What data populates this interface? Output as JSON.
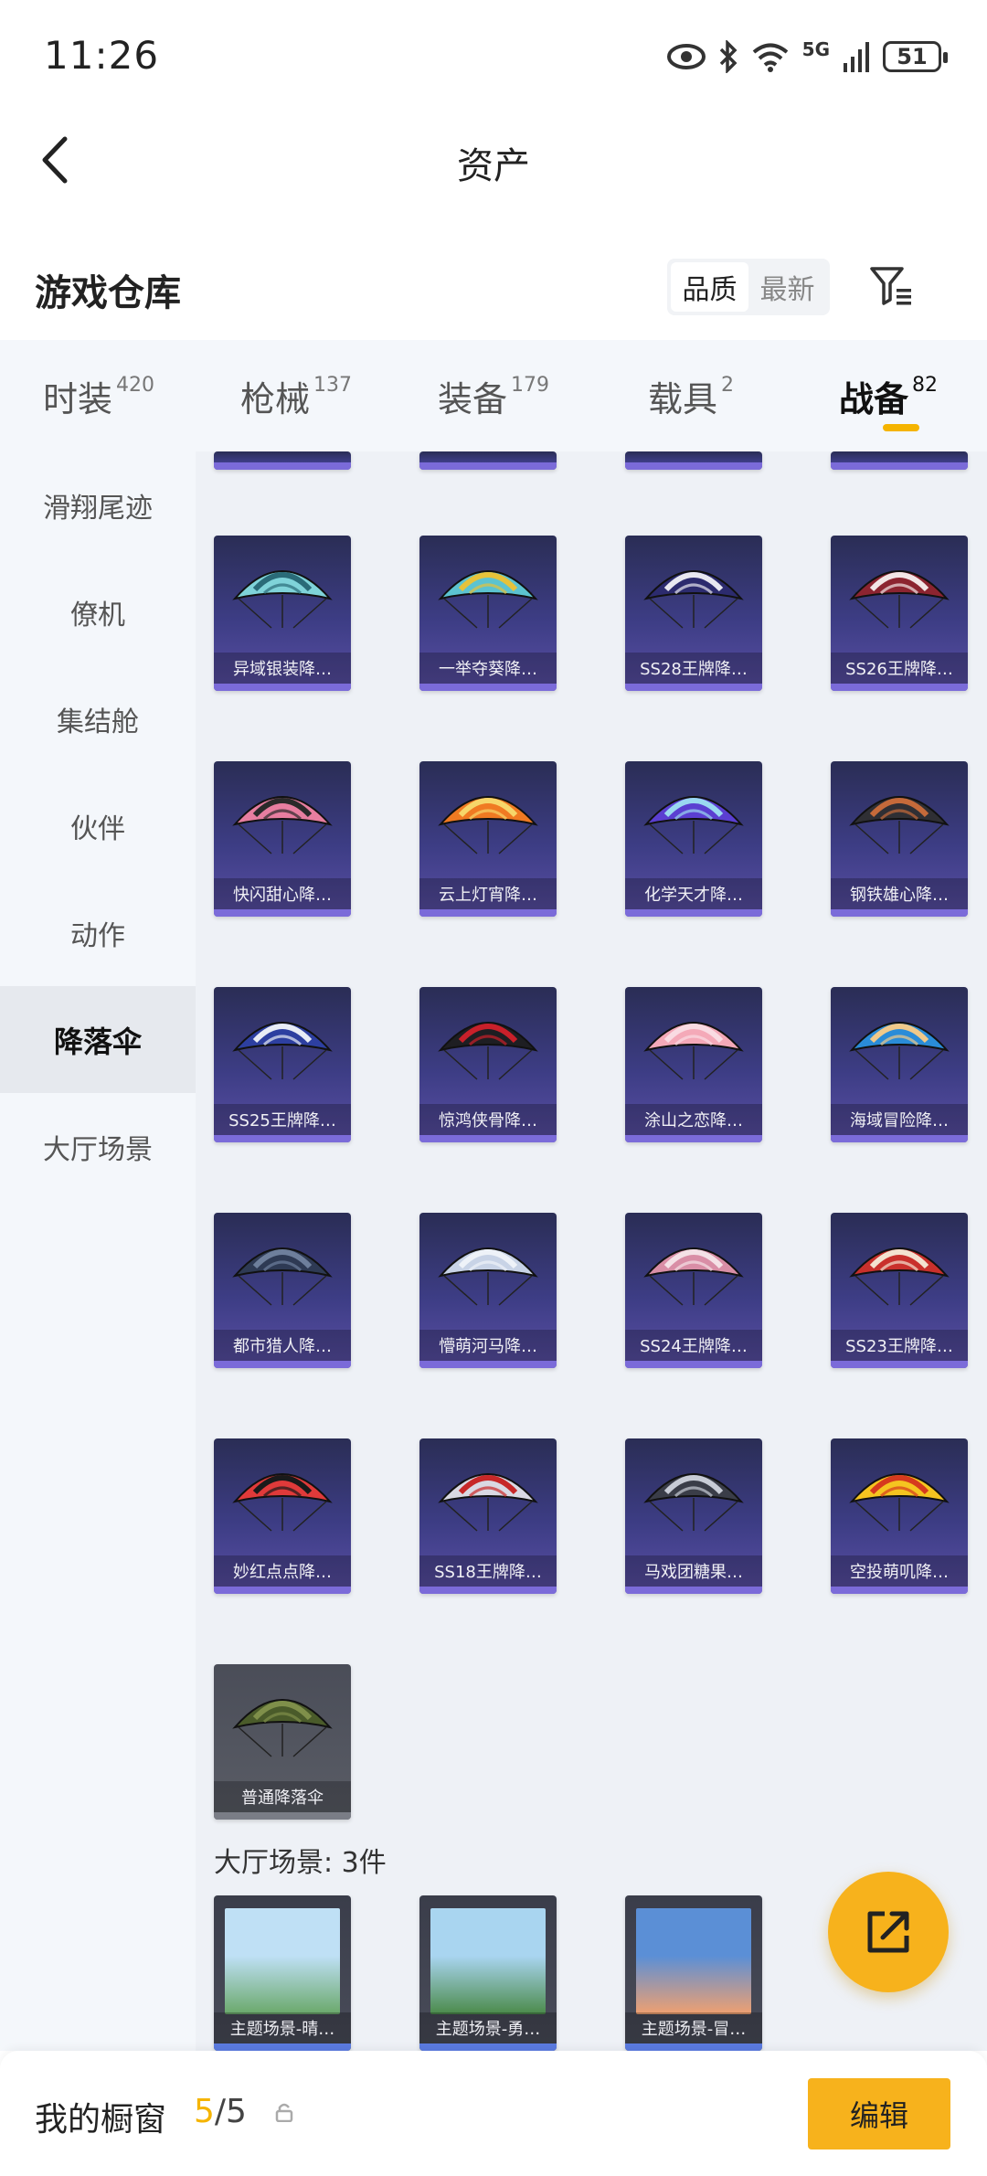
{
  "status_bar": {
    "time": "11:26",
    "network": "5G",
    "battery": "51"
  },
  "header": {
    "title": "资产"
  },
  "warehouse": {
    "title": "游戏仓库",
    "sort_options": [
      "品质",
      "最新"
    ],
    "sort_active": "品质"
  },
  "tabs": [
    {
      "label": "时装",
      "count": "420"
    },
    {
      "label": "枪械",
      "count": "137"
    },
    {
      "label": "装备",
      "count": "179"
    },
    {
      "label": "载具",
      "count": "2"
    },
    {
      "label": "战备",
      "count": "82",
      "active": true
    }
  ],
  "sidebar": {
    "items": [
      {
        "label": "滑翔尾迹"
      },
      {
        "label": "僚机"
      },
      {
        "label": "集结舱"
      },
      {
        "label": "伙伴"
      },
      {
        "label": "动作"
      },
      {
        "label": "降落伞",
        "active": true
      },
      {
        "label": "大厅场景"
      }
    ]
  },
  "items": [
    {
      "label": "异域银装降…",
      "colors": [
        "#7fd3d9",
        "#2a6b78"
      ]
    },
    {
      "label": "一举夺葵降…",
      "colors": [
        "#5cc3d0",
        "#e6c23a"
      ]
    },
    {
      "label": "SS28王牌降…",
      "colors": [
        "#2c2b6e",
        "#e8e8f0"
      ]
    },
    {
      "label": "SS26王牌降…",
      "colors": [
        "#8c2430",
        "#f2e6e6"
      ]
    },
    {
      "label": "快闪甜心降…",
      "colors": [
        "#e77ea0",
        "#2a2a2a"
      ]
    },
    {
      "label": "云上灯宵降…",
      "colors": [
        "#f07a22",
        "#f6d66a"
      ]
    },
    {
      "label": "化学天才降…",
      "colors": [
        "#5b3fd1",
        "#9ad8f0"
      ]
    },
    {
      "label": "钢铁雄心降…",
      "colors": [
        "#2f2f34",
        "#c56a3a"
      ]
    },
    {
      "label": "SS25王牌降…",
      "colors": [
        "#2d3fa0",
        "#e8ecf5"
      ]
    },
    {
      "label": "惊鸿侠骨降…",
      "colors": [
        "#1e1e22",
        "#c9202a"
      ]
    },
    {
      "label": "涂山之恋降…",
      "colors": [
        "#f4a9b8",
        "#f9dbe2"
      ]
    },
    {
      "label": "海域冒险降…",
      "colors": [
        "#2a8cd8",
        "#f0c98a"
      ]
    },
    {
      "label": "都市猎人降…",
      "colors": [
        "#2e3a54",
        "#6e7f9c"
      ]
    },
    {
      "label": "懵萌河马降…",
      "colors": [
        "#c8d3e6",
        "#eef2f8"
      ]
    },
    {
      "label": "SS24王牌降…",
      "colors": [
        "#d98ea6",
        "#f4e1e6"
      ]
    },
    {
      "label": "SS23王牌降…",
      "colors": [
        "#c9302c",
        "#f3e2d0"
      ]
    },
    {
      "label": "妙红点点降…",
      "colors": [
        "#e03a3a",
        "#1a1a1a"
      ]
    },
    {
      "label": "SS18王牌降…",
      "colors": [
        "#d9d9e3",
        "#c72828"
      ]
    },
    {
      "label": "马戏团糖果…",
      "colors": [
        "#3a3d48",
        "#c8ccd6"
      ]
    },
    {
      "label": "空投萌叽降…",
      "colors": [
        "#f5c420",
        "#d63a1e"
      ]
    },
    {
      "label": "普通降落伞",
      "colors": [
        "#4a5b2a",
        "#7f8f4a"
      ],
      "gray": true
    }
  ],
  "scenes_section": {
    "label": "大厅场景: 3件",
    "items": [
      {
        "label": "主题场景-晴…",
        "colors": [
          "#bfe0f5",
          "#6aa86a"
        ]
      },
      {
        "label": "主题场景-勇…",
        "colors": [
          "#a9d5f0",
          "#4b8a4a"
        ]
      },
      {
        "label": "主题场景-冒…",
        "colors": [
          "#5b8fd6",
          "#f0a070"
        ]
      }
    ]
  },
  "bottom_bar": {
    "window_label": "我的橱窗",
    "window_current": "5",
    "window_slash": "/",
    "window_max": "5",
    "edit_label": "编辑"
  }
}
